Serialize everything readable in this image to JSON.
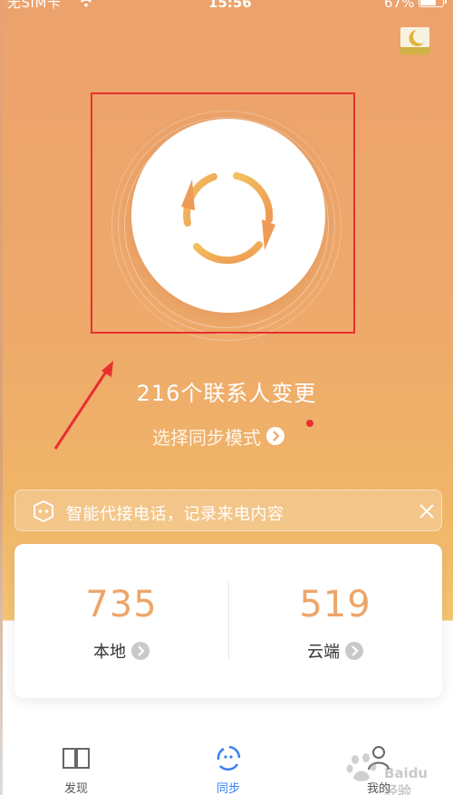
{
  "status_bar": {
    "carrier": "无SIM卡",
    "time": "15:56",
    "battery": "67%"
  },
  "sync": {
    "contacts_change": "216个联系人变更",
    "mode_link": "选择同步模式"
  },
  "banner": {
    "text": "智能代接电话，记录来电内容"
  },
  "stats": {
    "local": {
      "value": "735",
      "label": "本地"
    },
    "cloud": {
      "value": "519",
      "label": "云端"
    }
  },
  "tabs": [
    {
      "label": "发现"
    },
    {
      "label": "同步"
    },
    {
      "label": "我的"
    }
  ],
  "watermark": "Baidu经验",
  "colors": {
    "accent_orange": "#eea569",
    "active_tab": "#3a7ff6",
    "annotation_red": "#e8302f"
  }
}
